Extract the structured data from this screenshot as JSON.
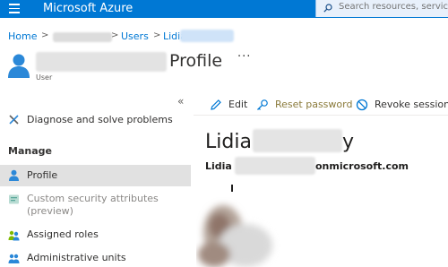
{
  "header": {
    "brand": "Microsoft Azure",
    "search_placeholder": "Search resources, services, and docs",
    "color": "#0078d4"
  },
  "breadcrumb": {
    "home": "Home",
    "users": "Users",
    "user": "Lidia"
  },
  "page": {
    "title": "Profile",
    "subtitle": "User",
    "more": "···"
  },
  "sidebar": {
    "collapse": "«",
    "diagnose": "Diagnose and solve problems",
    "section": "Manage",
    "items": [
      {
        "label": "Profile",
        "icon": "user-icon"
      },
      {
        "label": "Custom security attributes",
        "label2": "(preview)",
        "icon": "security-attributes-icon"
      },
      {
        "label": "Assigned roles",
        "icon": "roles-icon"
      },
      {
        "label": "Administrative units",
        "icon": "admin-units-icon"
      }
    ]
  },
  "toolbar": {
    "edit": "Edit",
    "reset": "Reset password",
    "revoke": "Revoke sessions"
  },
  "profile": {
    "name_start": "Lidia",
    "name_end": "y",
    "email_start": "Lidia",
    "email_end": "onmicrosoft.com"
  }
}
